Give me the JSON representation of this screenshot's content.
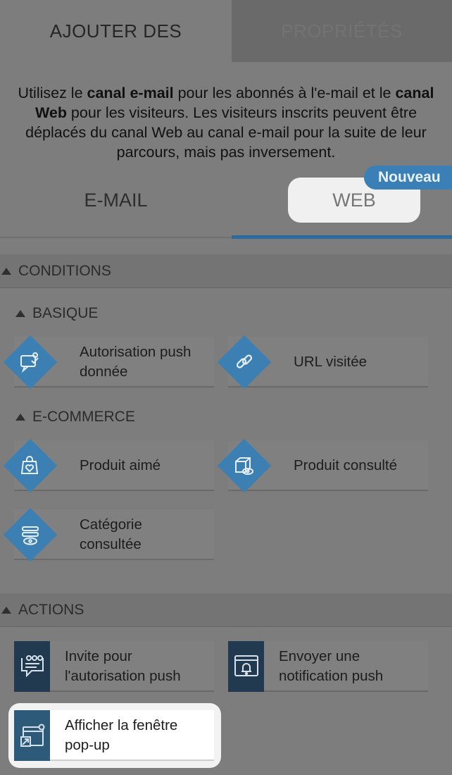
{
  "tabs": {
    "add": "AJOUTER DES",
    "properties": "PROPRIÉTÉS"
  },
  "intro": {
    "p1": "Utilisez le ",
    "b1": "canal e-mail",
    "p2": " pour les abonnés à l'e-mail et le ",
    "b2": "canal Web",
    "p3": " pour les visiteurs. Les visiteurs inscrits peuvent être déplacés du canal Web au canal e-mail pour la suite de leur parcours, mais pas inversement."
  },
  "channels": {
    "email": "E-MAIL",
    "web": "WEB",
    "new_badge": "Nouveau"
  },
  "conditions": {
    "title": "CONDITIONS",
    "basic": {
      "title": "BASIQUE",
      "items": [
        {
          "label_l1": "Autorisation push",
          "label_l2": "donnée",
          "icon": "push-permission-icon"
        },
        {
          "label_l1": "URL visitée",
          "icon": "link-icon"
        }
      ]
    },
    "ecommerce": {
      "title": "E-COMMERCE",
      "items": [
        {
          "label_l1": "Produit aimé",
          "icon": "bag-heart-icon"
        },
        {
          "label_l1": "Produit consulté",
          "icon": "box-eye-icon"
        },
        {
          "label_l1": "Catégorie",
          "label_l2": "consultée",
          "icon": "list-eye-icon"
        }
      ]
    }
  },
  "actions": {
    "title": "ACTIONS",
    "items": [
      {
        "label_l1": "Invite pour",
        "label_l2": "l'autorisation push",
        "icon": "chat-prompt-icon"
      },
      {
        "label_l1": "Envoyer une",
        "label_l2": "notification push",
        "icon": "bell-window-icon"
      },
      {
        "label_l1": "Afficher la fenêtre",
        "label_l2": "pop-up",
        "icon": "popup-window-icon"
      }
    ]
  },
  "colors": {
    "accent": "#3c7fb3",
    "action_icon_bg": "#223a4f",
    "background": "#7d7d7d"
  }
}
